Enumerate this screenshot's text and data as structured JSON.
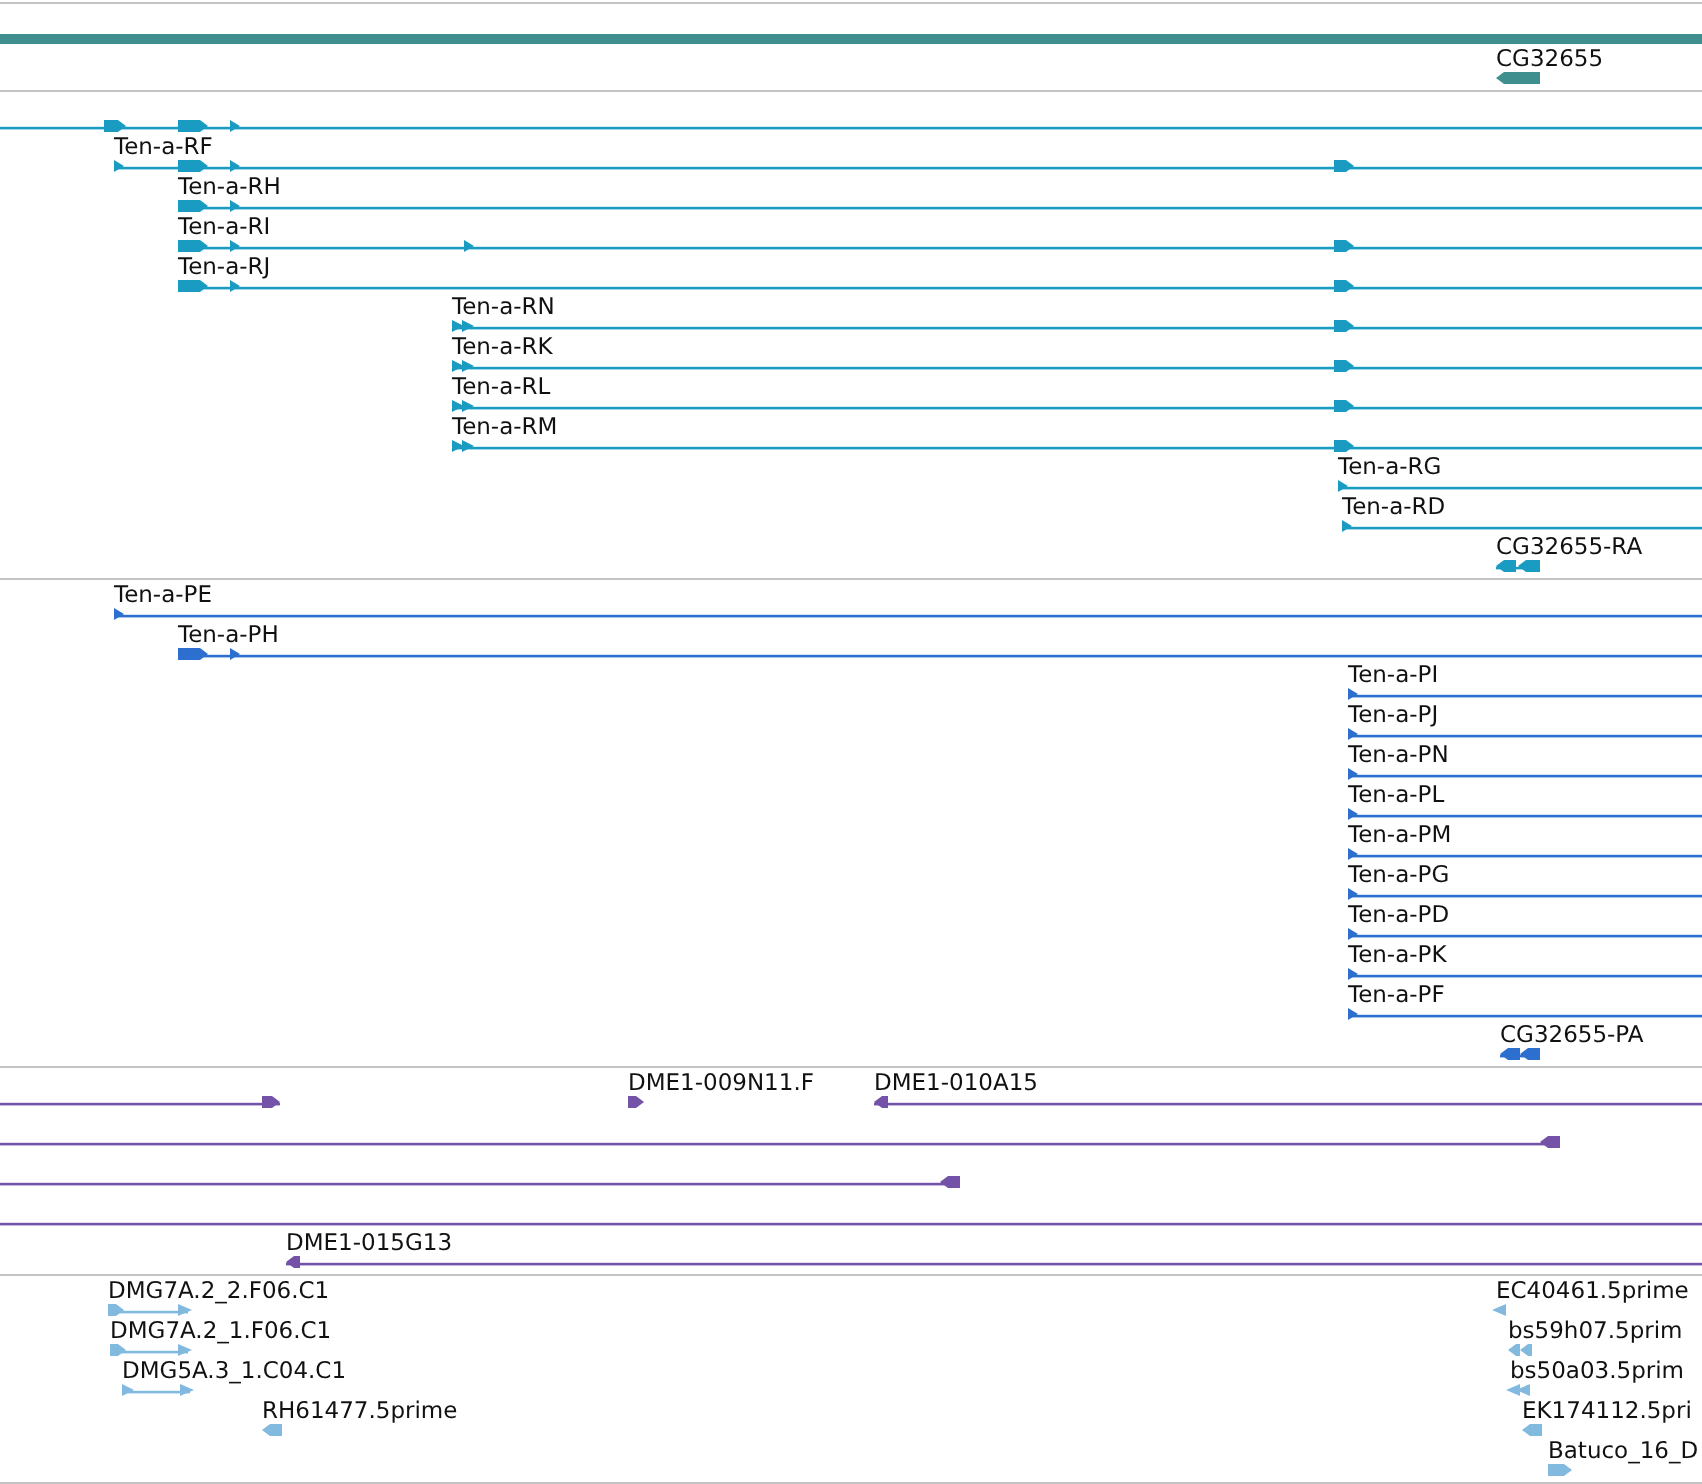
{
  "tracks": [
    {
      "color": "#3f8f8f",
      "features": [
        {
          "kind": "summary"
        },
        {
          "kind": "gene",
          "label": "CG32655",
          "reverse": true
        }
      ]
    },
    {
      "color": "#1a9cc2",
      "features": [
        {
          "kind": "transcript",
          "reverse": false
        },
        {
          "kind": "transcript",
          "label": "Ten-a-RF",
          "reverse": false
        },
        {
          "kind": "transcript",
          "label": "Ten-a-RH",
          "reverse": false
        },
        {
          "kind": "transcript",
          "label": "Ten-a-RI",
          "reverse": false
        },
        {
          "kind": "transcript",
          "label": "Ten-a-RJ",
          "reverse": false
        },
        {
          "kind": "transcript",
          "label": "Ten-a-RN",
          "reverse": false
        },
        {
          "kind": "transcript",
          "label": "Ten-a-RK",
          "reverse": false
        },
        {
          "kind": "transcript",
          "label": "Ten-a-RL",
          "reverse": false
        },
        {
          "kind": "transcript",
          "label": "Ten-a-RM",
          "reverse": false
        },
        {
          "kind": "transcript",
          "label": "Ten-a-RG",
          "reverse": false
        },
        {
          "kind": "transcript",
          "label": "Ten-a-RD",
          "reverse": false
        },
        {
          "kind": "transcript",
          "label": "CG32655-RA",
          "reverse": true
        }
      ]
    },
    {
      "color": "#2c6fce",
      "features": [
        {
          "kind": "transcript",
          "label": "Ten-a-PE",
          "reverse": false
        },
        {
          "kind": "transcript",
          "label": "Ten-a-PH",
          "reverse": false
        },
        {
          "kind": "transcript",
          "label": "Ten-a-PI",
          "reverse": false
        },
        {
          "kind": "transcript",
          "label": "Ten-a-PJ",
          "reverse": false
        },
        {
          "kind": "transcript",
          "label": "Ten-a-PN",
          "reverse": false
        },
        {
          "kind": "transcript",
          "label": "Ten-a-PL",
          "reverse": false
        },
        {
          "kind": "transcript",
          "label": "Ten-a-PM",
          "reverse": false
        },
        {
          "kind": "transcript",
          "label": "Ten-a-PG",
          "reverse": false
        },
        {
          "kind": "transcript",
          "label": "Ten-a-PD",
          "reverse": false
        },
        {
          "kind": "transcript",
          "label": "Ten-a-PK",
          "reverse": false
        },
        {
          "kind": "transcript",
          "label": "Ten-a-PF",
          "reverse": false
        },
        {
          "kind": "transcript",
          "label": "CG32655-PA",
          "reverse": true
        }
      ]
    },
    {
      "color": "#7352a8",
      "features": [
        {
          "kind": "transcript",
          "reverse": false
        },
        {
          "kind": "transcript",
          "label": "DME1-009N11.F",
          "reverse": false
        },
        {
          "kind": "transcript",
          "label": "DME1-010A15",
          "reverse": true
        },
        {
          "kind": "transcript",
          "reverse": true
        },
        {
          "kind": "transcript",
          "reverse": true
        },
        {
          "kind": "transcript"
        },
        {
          "kind": "transcript",
          "label": "DME1-015G13",
          "reverse": true
        }
      ]
    },
    {
      "color": "#82b9df",
      "features": [
        {
          "kind": "transcript",
          "label": "DMG7A.2_2.F06.C1",
          "reverse": false
        },
        {
          "kind": "transcript",
          "label": "DMG7A.2_1.F06.C1",
          "reverse": false
        },
        {
          "kind": "transcript",
          "label": "DMG5A.3_1.C04.C1",
          "reverse": false
        },
        {
          "kind": "transcript",
          "label": "RH61477.5prime",
          "reverse": true
        },
        {
          "kind": "transcript",
          "label": "EC40461.5prime",
          "reverse": true
        },
        {
          "kind": "transcript",
          "label": "bs59h07.5prim",
          "reverse": true
        },
        {
          "kind": "transcript",
          "label": "bs50a03.5prim",
          "reverse": true
        },
        {
          "kind": "transcript",
          "label": "EK174112.5pri",
          "reverse": true
        },
        {
          "kind": "transcript",
          "label": "Batuco_16_D",
          "reverse": false
        }
      ]
    }
  ]
}
